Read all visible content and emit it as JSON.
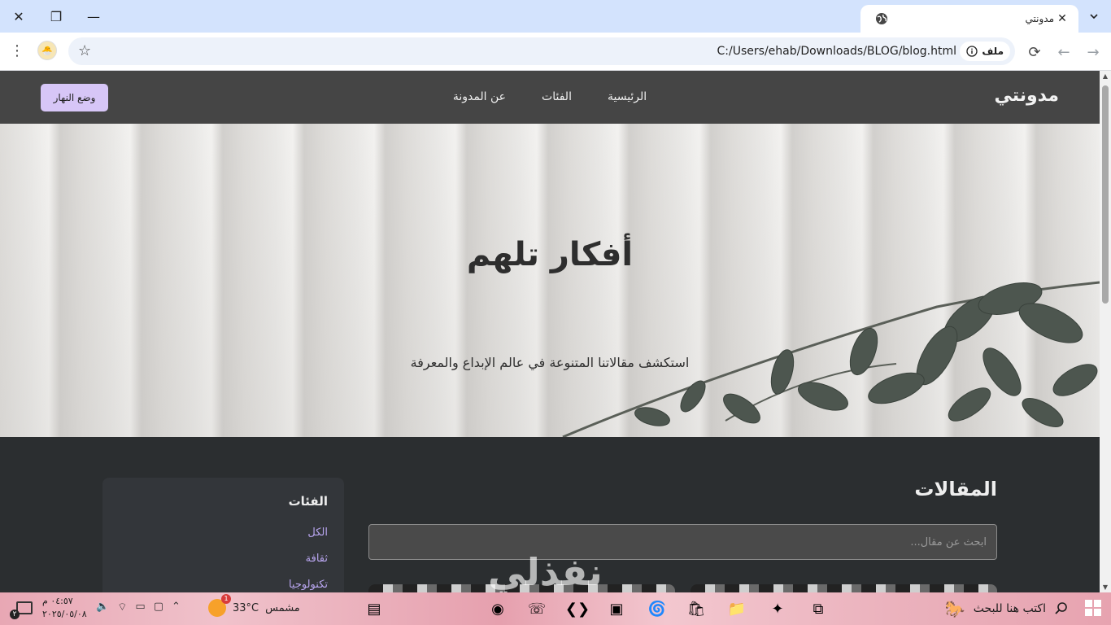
{
  "browser": {
    "tab_title": "مدونتي",
    "url": "C:/Users/ehab/Downloads/BLOG/blog.html",
    "site_info_label": "ملف",
    "new_tab": "+",
    "tab_close": "✕",
    "window_controls": {
      "close": "✕",
      "restore": "❐",
      "minimize": "—"
    }
  },
  "site": {
    "brand": "مدونتي",
    "nav": [
      "الرئيسية",
      "الفئات",
      "عن المدونة"
    ],
    "mode_button": "وضع النهار",
    "hero": {
      "title": "أفكار تلهم",
      "subtitle": "استكشف مقالاتنا المتنوعة في عالم الإبداع والمعرفة"
    },
    "articles": {
      "title": "المقالات",
      "search_placeholder": "ابحث عن مقال..."
    },
    "sidebar": {
      "title": "الفئات",
      "links": [
        "الكل",
        "ثقافة",
        "تكنولوجيا"
      ]
    }
  },
  "taskbar": {
    "search_text": "اكتب هنا للبحث",
    "weather_temp": "33°C",
    "weather_desc": "مشمس",
    "weather_badge": "1",
    "time": "٠٤:٥٧ م",
    "date": "٢٠٢٥/٠٥/٠٨",
    "notification_count": "٢"
  },
  "watermark": "نفذلي",
  "colors": {
    "tabstrip": "#d3e3fd",
    "navbar": "#454545",
    "page_bg": "#2b2e30",
    "mode_button": "#d7c6f7",
    "category_link": "#b9a6f0"
  }
}
